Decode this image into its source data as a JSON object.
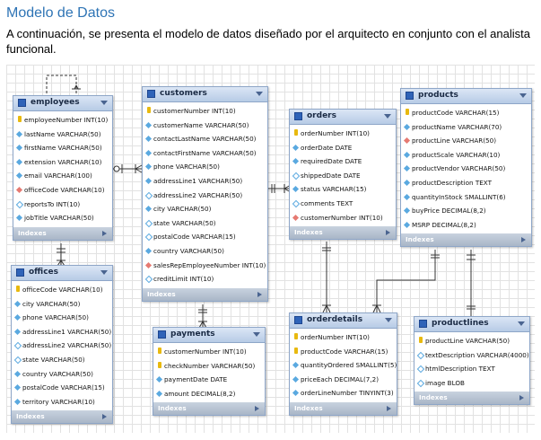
{
  "heading": "Modelo de Datos",
  "intro": "A continuación, se presenta el modelo de datos diseñado por el arquitecto en conjunto con el analista funcional.",
  "indexes_label": "Indexes",
  "tables": {
    "employees": {
      "name": "employees",
      "columns": [
        {
          "text": "employeeNumber INT(10)",
          "kind": "pk"
        },
        {
          "text": "lastName VARCHAR(50)",
          "kind": "col"
        },
        {
          "text": "firstName VARCHAR(50)",
          "kind": "col"
        },
        {
          "text": "extension VARCHAR(10)",
          "kind": "col"
        },
        {
          "text": "email VARCHAR(100)",
          "kind": "col"
        },
        {
          "text": "officeCode VARCHAR(10)",
          "kind": "fk"
        },
        {
          "text": "reportsTo INT(10)",
          "kind": "nn"
        },
        {
          "text": "jobTitle VARCHAR(50)",
          "kind": "col"
        }
      ]
    },
    "customers": {
      "name": "customers",
      "columns": [
        {
          "text": "customerNumber INT(10)",
          "kind": "pk"
        },
        {
          "text": "customerName VARCHAR(50)",
          "kind": "col"
        },
        {
          "text": "contactLastName VARCHAR(50)",
          "kind": "col"
        },
        {
          "text": "contactFirstName VARCHAR(50)",
          "kind": "col"
        },
        {
          "text": "phone VARCHAR(50)",
          "kind": "col"
        },
        {
          "text": "addressLine1 VARCHAR(50)",
          "kind": "col"
        },
        {
          "text": "addressLine2 VARCHAR(50)",
          "kind": "nn"
        },
        {
          "text": "city VARCHAR(50)",
          "kind": "col"
        },
        {
          "text": "state VARCHAR(50)",
          "kind": "nn"
        },
        {
          "text": "postalCode VARCHAR(15)",
          "kind": "nn"
        },
        {
          "text": "country VARCHAR(50)",
          "kind": "col"
        },
        {
          "text": "salesRepEmployeeNumber INT(10)",
          "kind": "fk"
        },
        {
          "text": "creditLimit INT(10)",
          "kind": "nn"
        }
      ]
    },
    "orders": {
      "name": "orders",
      "columns": [
        {
          "text": "orderNumber INT(10)",
          "kind": "pk"
        },
        {
          "text": "orderDate DATE",
          "kind": "col"
        },
        {
          "text": "requiredDate DATE",
          "kind": "col"
        },
        {
          "text": "shippedDate DATE",
          "kind": "nn"
        },
        {
          "text": "status VARCHAR(15)",
          "kind": "col"
        },
        {
          "text": "comments TEXT",
          "kind": "nn"
        },
        {
          "text": "customerNumber INT(10)",
          "kind": "fk"
        }
      ]
    },
    "products": {
      "name": "products",
      "columns": [
        {
          "text": "productCode VARCHAR(15)",
          "kind": "pk"
        },
        {
          "text": "productName VARCHAR(70)",
          "kind": "col"
        },
        {
          "text": "productLine VARCHAR(50)",
          "kind": "fk"
        },
        {
          "text": "productScale VARCHAR(10)",
          "kind": "col"
        },
        {
          "text": "productVendor VARCHAR(50)",
          "kind": "col"
        },
        {
          "text": "productDescription TEXT",
          "kind": "col"
        },
        {
          "text": "quantityInStock SMALLINT(6)",
          "kind": "col"
        },
        {
          "text": "buyPrice DECIMAL(8,2)",
          "kind": "col"
        },
        {
          "text": "MSRP DECIMAL(8,2)",
          "kind": "col"
        }
      ]
    },
    "offices": {
      "name": "offices",
      "columns": [
        {
          "text": "officeCode VARCHAR(10)",
          "kind": "pk"
        },
        {
          "text": "city VARCHAR(50)",
          "kind": "col"
        },
        {
          "text": "phone VARCHAR(50)",
          "kind": "col"
        },
        {
          "text": "addressLine1 VARCHAR(50)",
          "kind": "col"
        },
        {
          "text": "addressLine2 VARCHAR(50)",
          "kind": "nn"
        },
        {
          "text": "state VARCHAR(50)",
          "kind": "nn"
        },
        {
          "text": "country VARCHAR(50)",
          "kind": "col"
        },
        {
          "text": "postalCode VARCHAR(15)",
          "kind": "col"
        },
        {
          "text": "territory VARCHAR(10)",
          "kind": "col"
        }
      ]
    },
    "payments": {
      "name": "payments",
      "columns": [
        {
          "text": "customerNumber INT(10)",
          "kind": "pk"
        },
        {
          "text": "checkNumber VARCHAR(50)",
          "kind": "pk"
        },
        {
          "text": "paymentDate DATE",
          "kind": "col"
        },
        {
          "text": "amount DECIMAL(8,2)",
          "kind": "col"
        }
      ]
    },
    "orderdetails": {
      "name": "orderdetails",
      "columns": [
        {
          "text": "orderNumber INT(10)",
          "kind": "pk"
        },
        {
          "text": "productCode VARCHAR(15)",
          "kind": "pk"
        },
        {
          "text": "quantityOrdered SMALLINT(5)",
          "kind": "col"
        },
        {
          "text": "priceEach DECIMAL(7,2)",
          "kind": "col"
        },
        {
          "text": "orderLineNumber TINYINT(3)",
          "kind": "col"
        }
      ]
    },
    "productlines": {
      "name": "productlines",
      "columns": [
        {
          "text": "productLine VARCHAR(50)",
          "kind": "pk"
        },
        {
          "text": "textDescription VARCHAR(4000)",
          "kind": "nn"
        },
        {
          "text": "htmlDescription TEXT",
          "kind": "nn"
        },
        {
          "text": "image BLOB",
          "kind": "nn"
        }
      ]
    }
  }
}
